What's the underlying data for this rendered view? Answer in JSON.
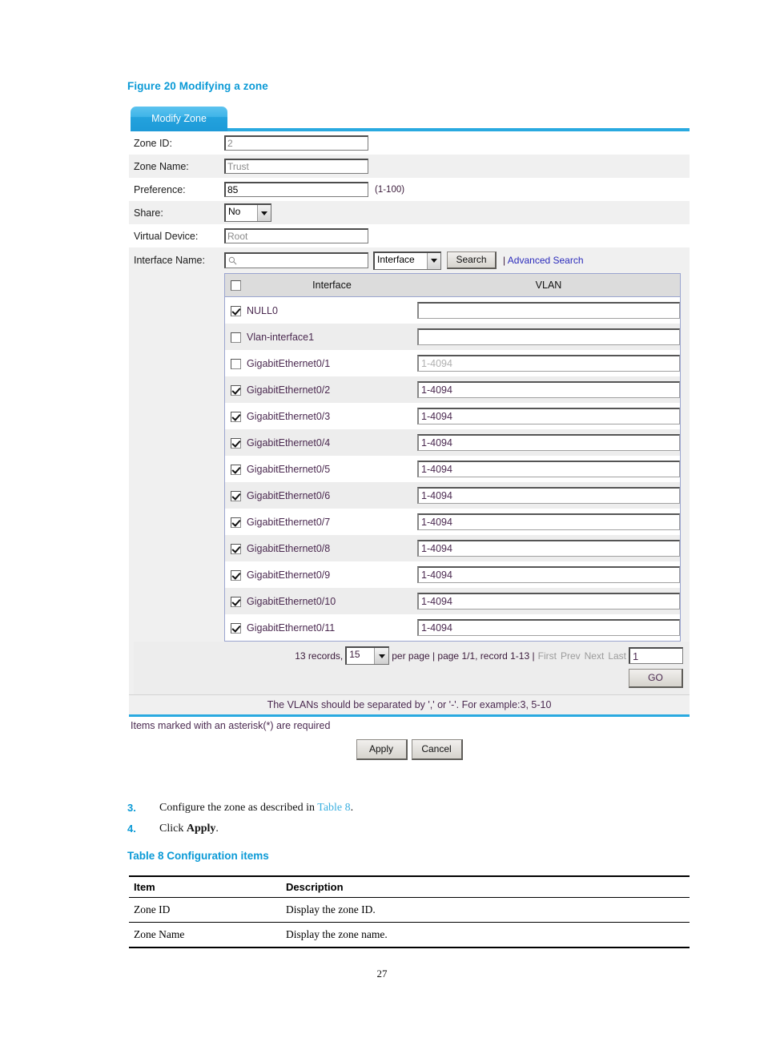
{
  "figure": {
    "caption": "Figure 20 Modifying a zone"
  },
  "screenshot": {
    "tab": {
      "label": "Modify Zone"
    },
    "form": {
      "zone_id": {
        "label": "Zone ID:",
        "value": "2"
      },
      "zone_name": {
        "label": "Zone Name:",
        "value": "Trust"
      },
      "preference": {
        "label": "Preference:",
        "value": "85",
        "hint": "(1-100)"
      },
      "share": {
        "label": "Share:",
        "value": "No"
      },
      "virtual_device": {
        "label": "Virtual Device:",
        "value": "Root"
      },
      "interface_name": {
        "label": "Interface Name:",
        "value": ""
      }
    },
    "search": {
      "field_placeholder": "",
      "scope_value": "Interface",
      "button_label": "Search",
      "separator": "|",
      "advanced_label": "Advanced Search"
    },
    "table": {
      "columns": [
        "",
        "Interface",
        "VLAN"
      ],
      "header_checkbox_checked": false,
      "rows": [
        {
          "checked": true,
          "interface": "NULL0",
          "vlan": "",
          "vlan_dim": false
        },
        {
          "checked": false,
          "interface": "Vlan-interface1",
          "vlan": "",
          "vlan_dim": false
        },
        {
          "checked": false,
          "interface": "GigabitEthernet0/1",
          "vlan": "1-4094",
          "vlan_dim": true
        },
        {
          "checked": true,
          "interface": "GigabitEthernet0/2",
          "vlan": "1-4094",
          "vlan_dim": false
        },
        {
          "checked": true,
          "interface": "GigabitEthernet0/3",
          "vlan": "1-4094",
          "vlan_dim": false
        },
        {
          "checked": true,
          "interface": "GigabitEthernet0/4",
          "vlan": "1-4094",
          "vlan_dim": false
        },
        {
          "checked": true,
          "interface": "GigabitEthernet0/5",
          "vlan": "1-4094",
          "vlan_dim": false
        },
        {
          "checked": true,
          "interface": "GigabitEthernet0/6",
          "vlan": "1-4094",
          "vlan_dim": false
        },
        {
          "checked": true,
          "interface": "GigabitEthernet0/7",
          "vlan": "1-4094",
          "vlan_dim": false
        },
        {
          "checked": true,
          "interface": "GigabitEthernet0/8",
          "vlan": "1-4094",
          "vlan_dim": false
        },
        {
          "checked": true,
          "interface": "GigabitEthernet0/9",
          "vlan": "1-4094",
          "vlan_dim": false
        },
        {
          "checked": true,
          "interface": "GigabitEthernet0/10",
          "vlan": "1-4094",
          "vlan_dim": false
        },
        {
          "checked": true,
          "interface": "GigabitEthernet0/11",
          "vlan": "1-4094",
          "vlan_dim": false
        }
      ]
    },
    "pager": {
      "records_text": "13 records,",
      "per_page_value": "15",
      "per_page_text": "per page | page 1/1, record 1-13 |",
      "first": "First",
      "prev": "Prev",
      "next": "Next",
      "last": "Last",
      "page_input_value": "1",
      "go_label": "GO"
    },
    "note": "The VLANs should be separated by ',' or '-'. For example:3, 5-10",
    "required_note": "Items marked with an asterisk(*) are required",
    "buttons": {
      "apply": "Apply",
      "cancel": "Cancel"
    }
  },
  "steps": [
    {
      "num": "3.",
      "pre": "Configure the zone as described in ",
      "link": "Table 8",
      "post": "."
    },
    {
      "num": "4.",
      "pre": "Click ",
      "bold": "Apply",
      "post": "."
    }
  ],
  "table8": {
    "caption": "Table 8 Configuration items",
    "columns": [
      "Item",
      "Description"
    ],
    "rows": [
      {
        "item": "Zone ID",
        "description": "Display the zone ID."
      },
      {
        "item": "Zone Name",
        "description": "Display the zone name."
      }
    ]
  },
  "page_number": "27"
}
